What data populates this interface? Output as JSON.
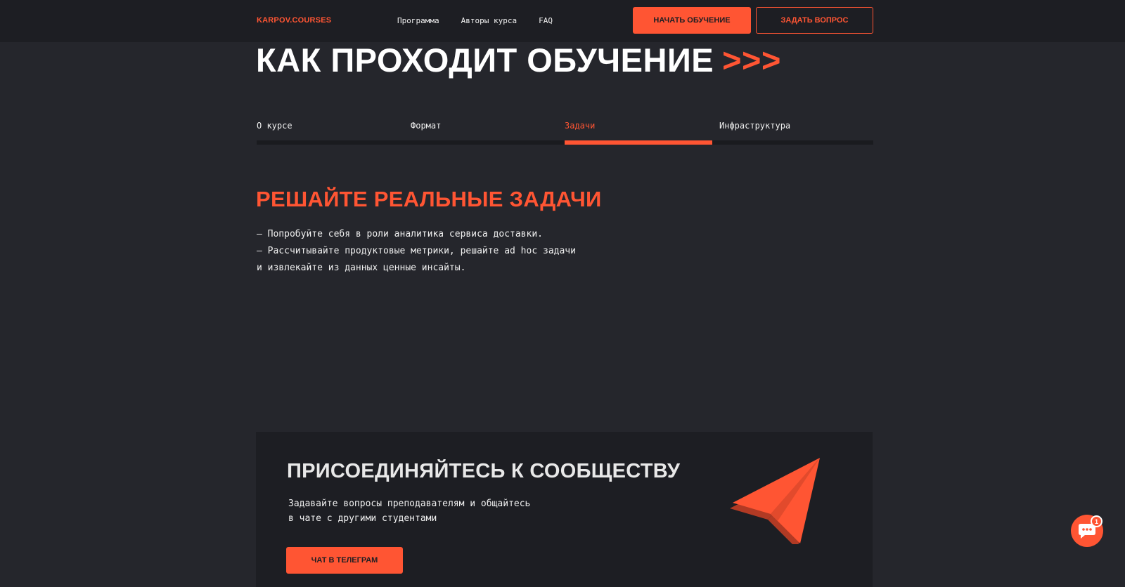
{
  "header": {
    "logo": "KARPOV.COURSES",
    "nav": [
      {
        "label": "Программа"
      },
      {
        "label": "Авторы курса"
      },
      {
        "label": "FAQ"
      }
    ],
    "start_button": "НАЧАТЬ ОБУЧЕНИЕ",
    "ask_button": "ЗАДАТЬ ВОПРОС"
  },
  "section": {
    "title": "КАК ПРОХОДИТ ОБУЧЕНИЕ",
    "title_arrows": ">>>"
  },
  "tabs": [
    {
      "label": "О курсе",
      "active": false
    },
    {
      "label": "Формат",
      "active": false
    },
    {
      "label": "Задачи",
      "active": true
    },
    {
      "label": "Инфраструктура",
      "active": false
    }
  ],
  "content": {
    "heading": "РЕШАЙТЕ РЕАЛЬНЫЕ ЗАДАЧИ",
    "lines": [
      "— Попробуйте себя в роли аналитика сервиса доставки.",
      "— Рассчитывайте продуктовые метрики, решайте ad hoc задачи",
      "и извлекайте из данных ценные инсайты."
    ]
  },
  "community": {
    "title": "ПРИСОЕДИНЯЙТЕСЬ К СООБЩЕСТВУ",
    "lines": [
      "Задавайте вопросы преподавателям и общайтесь",
      "в чате с другими студентами"
    ],
    "button": "ЧАТ В ТЕЛЕГРАМ",
    "icon": "paper-plane-icon"
  },
  "chat_widget": {
    "icon": "chat-bubble-icon",
    "badge_count": "1"
  },
  "colors": {
    "accent": "#ff5533",
    "background": "#25262c",
    "header": "#1d1e23",
    "card": "#1d1e23"
  }
}
